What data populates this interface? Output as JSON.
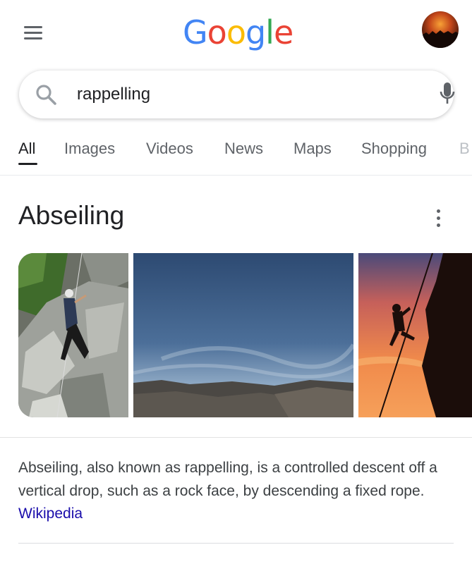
{
  "header": {
    "menu_icon": "hamburger-menu-icon",
    "logo_letters": [
      {
        "ch": "G",
        "color": "#4285F4"
      },
      {
        "ch": "o",
        "color": "#EA4335"
      },
      {
        "ch": "o",
        "color": "#FBBC05"
      },
      {
        "ch": "g",
        "color": "#4285F4"
      },
      {
        "ch": "l",
        "color": "#34A853"
      },
      {
        "ch": "e",
        "color": "#EA4335"
      }
    ],
    "avatar_icon": "account-avatar"
  },
  "search": {
    "query": "rappelling",
    "search_icon": "search-icon",
    "mic_icon": "microphone-icon"
  },
  "tabs": [
    {
      "label": "All",
      "active": true
    },
    {
      "label": "Images",
      "active": false
    },
    {
      "label": "Videos",
      "active": false
    },
    {
      "label": "News",
      "active": false
    },
    {
      "label": "Maps",
      "active": false
    },
    {
      "label": "Shopping",
      "active": false
    },
    {
      "label": "B",
      "active": false
    }
  ],
  "knowledge_panel": {
    "title": "Abseiling",
    "more_icon": "more-vert-icon",
    "images": [
      "climber on rock face",
      "sky over rocky plain",
      "silhouette rappelling at sunset"
    ],
    "description": "Abseiling, also known as rappelling, is a controlled descent off a vertical drop, such as a rock face, by descending a fixed rope.",
    "source_link": "Wikipedia"
  },
  "colors": {
    "link": "#1a0dab",
    "text": "#202124",
    "secondary": "#5f6368"
  }
}
